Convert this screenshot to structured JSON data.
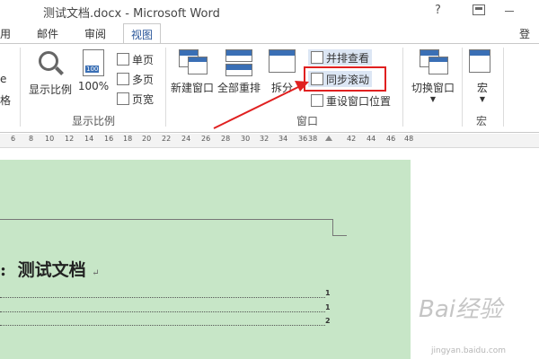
{
  "title": "测试文档.docx - Microsoft Word",
  "title_help": "?",
  "tabs": [
    "用",
    "邮件",
    "审阅",
    "视图"
  ],
  "login": "登录",
  "ribbon": {
    "view_group": {
      "left_partial_a": "e",
      "left_partial_b": "格",
      "zoom_label": "显示比例",
      "percent_label": "100%",
      "one_page": "单页",
      "multi_page": "多页",
      "page_width": "页宽",
      "group_label": "显示比例"
    },
    "window_group": {
      "new_window": "新建窗口",
      "arrange_all": "全部重排",
      "split": "拆分",
      "side_by_side": "并排查看",
      "sync_scroll": "同步滚动",
      "reset_position": "重设窗口位置",
      "switch_windows": "切换窗口",
      "group_label": "窗口"
    },
    "macro_group": {
      "macro": "宏",
      "group_label": "宏"
    }
  },
  "ruler": [
    "6",
    "8",
    "10",
    "12",
    "14",
    "16",
    "18",
    "20",
    "22",
    "24",
    "26",
    "28",
    "30",
    "32",
    "34",
    "36",
    "38",
    "42",
    "44",
    "46",
    "48"
  ],
  "document": {
    "heading": "测试文档",
    "heading_prefix": ":",
    "paragraph_mark": "↵",
    "toc_numbers": [
      "1",
      "1",
      "2"
    ]
  },
  "watermark": {
    "logo": "Bai经验",
    "url": "jingyan.baidu.com"
  },
  "colors": {
    "accent": "#2b579a",
    "page_bg": "#c7e6c7",
    "highlight": "#e02020"
  }
}
